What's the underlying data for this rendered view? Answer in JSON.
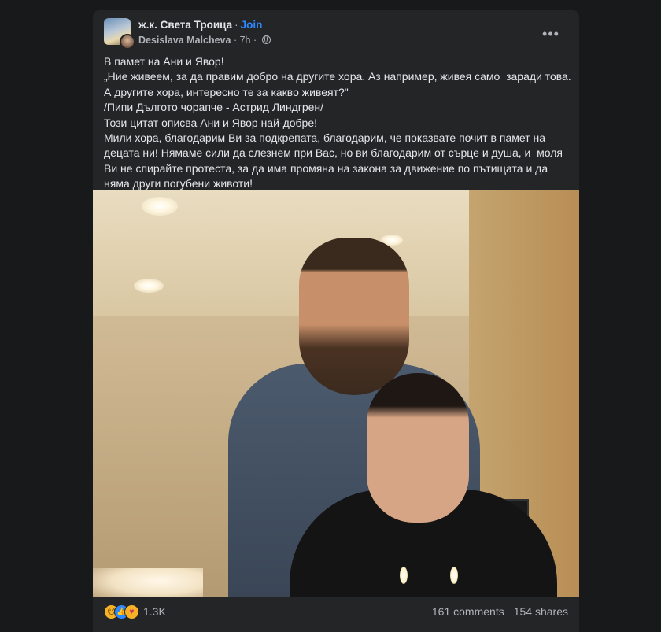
{
  "post": {
    "group_name": "ж.к. Света Троица",
    "separator": "·",
    "join_label": "Join",
    "author": "Desislava Malcheva",
    "time": "7h",
    "more_label": "•••",
    "text": "В памет на Ани и Явор!\n„Ние живеем, за да правим добро на другите хора. Аз например, живея само  заради това.\nА другите хора, интересно те за какво живеят?\"\n/Пипи Дългото чорапче - Астрид Линдгрен/\nТози цитат описва Ани и Явор най-добре!\nМили хора, благодарим Ви за подкрепата, благодарим, че показвате почит в памет на\nдецата ни! Нямаме сили да слезнем при Вас, но ви благодарим от сърце и душа, и  моля\nВи не спирайте протеста, за да има промяна на закона за движение по пътищата и да\nняма други погубени животи!"
  },
  "footer": {
    "reactions": [
      "sad",
      "like",
      "care"
    ],
    "reaction_count": "1.3K",
    "comments": "161 comments",
    "shares": "154 shares"
  },
  "icons": {
    "globe": "globe-icon",
    "sad": "sad-reaction-icon",
    "like": "like-reaction-icon",
    "care": "care-reaction-icon"
  },
  "colors": {
    "background": "#18191a",
    "card": "#242526",
    "text": "#e4e6eb",
    "secondary_text": "#b0b3b8",
    "link": "#2d88ff"
  }
}
